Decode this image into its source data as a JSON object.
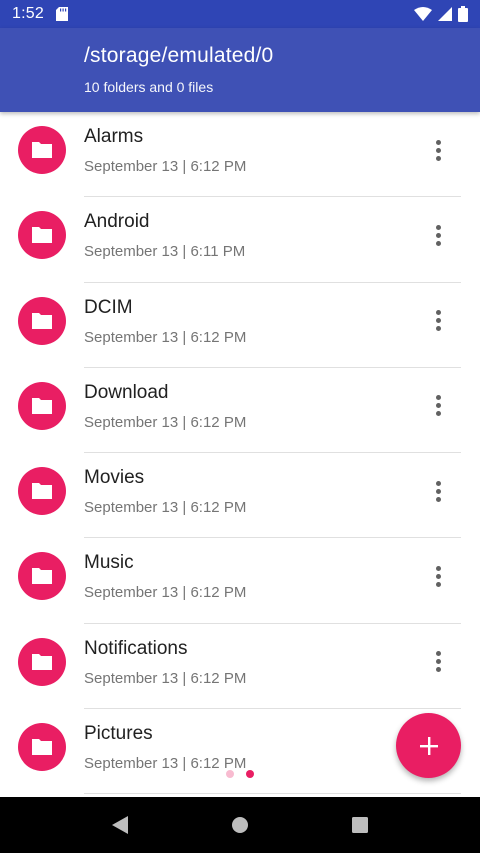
{
  "status_bar": {
    "time": "1:52"
  },
  "app_bar": {
    "path": "/storage/emulated/0",
    "summary": "10 folders and 0 files"
  },
  "folders": [
    {
      "name": "Alarms",
      "date": "September 13 | 6:12 PM"
    },
    {
      "name": "Android",
      "date": "September 13 | 6:11 PM"
    },
    {
      "name": "DCIM",
      "date": "September 13 | 6:12 PM"
    },
    {
      "name": "Download",
      "date": "September 13 | 6:12 PM"
    },
    {
      "name": "Movies",
      "date": "September 13 | 6:12 PM"
    },
    {
      "name": "Music",
      "date": "September 13 | 6:12 PM"
    },
    {
      "name": "Notifications",
      "date": "September 13 | 6:12 PM"
    },
    {
      "name": "Pictures",
      "date": "September 13 | 6:12 PM"
    }
  ],
  "colors": {
    "primary": "#3f51b5",
    "status_bar": "#2f45b5",
    "accent": "#e91e63"
  },
  "icons": {
    "folder": "folder-icon",
    "more": "more-vert-icon",
    "fab": "add-icon"
  }
}
